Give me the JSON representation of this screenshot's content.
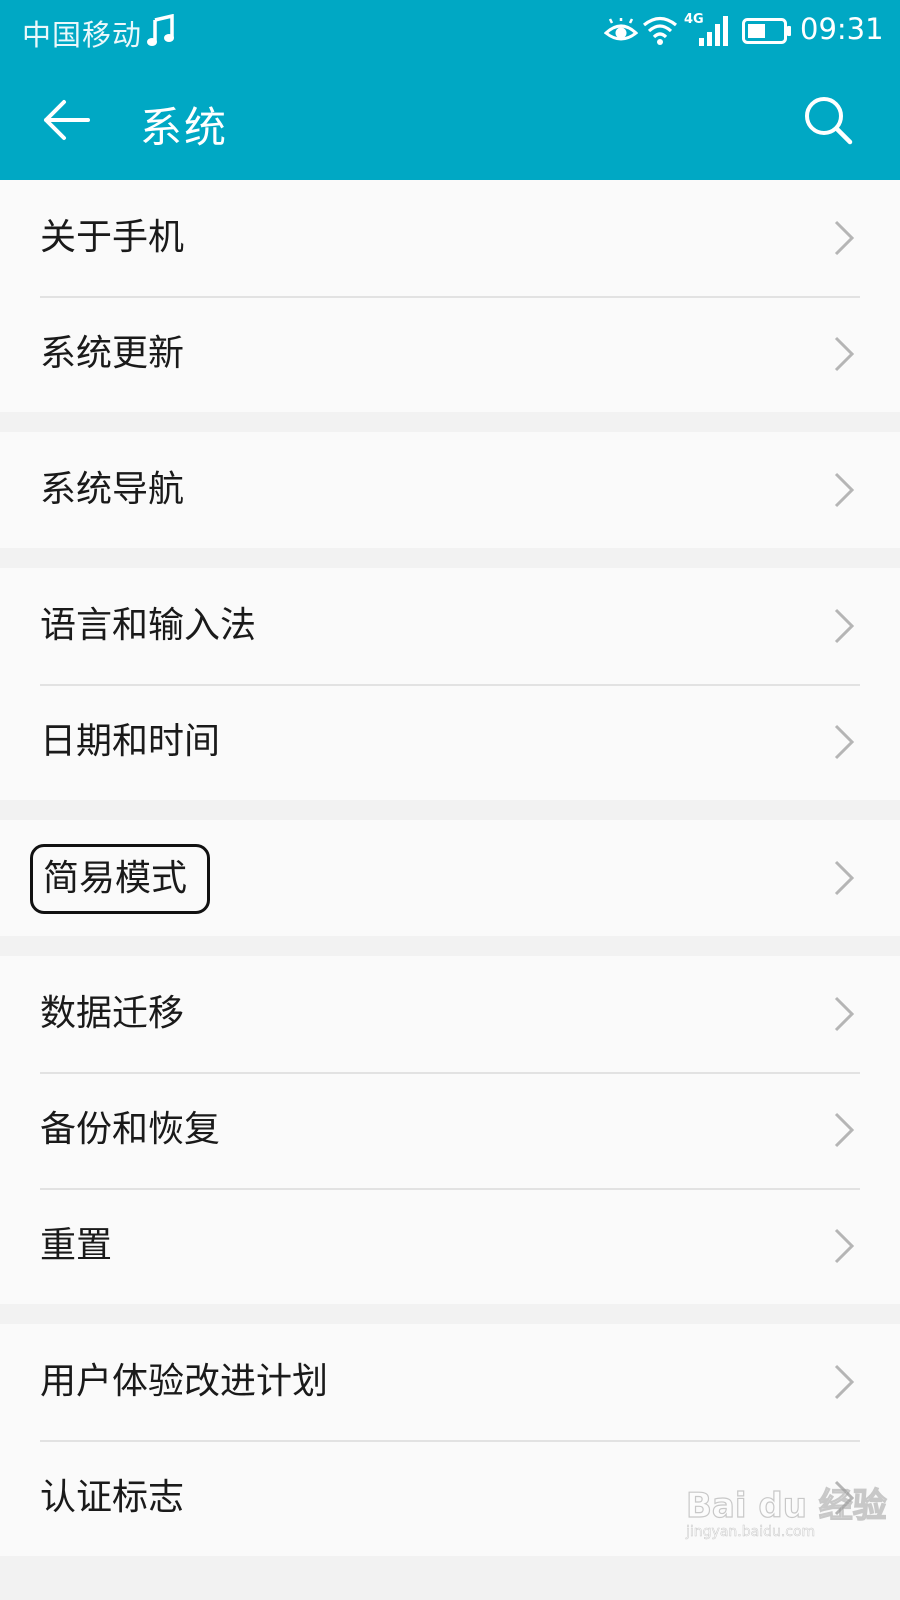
{
  "status_bar": {
    "carrier": "中国移动",
    "network": "4G",
    "time": "09:31",
    "icons": [
      "music-icon",
      "eye-icon",
      "wifi-icon",
      "signal-icon",
      "battery-icon"
    ]
  },
  "header": {
    "title": "系统",
    "back_icon": "back-arrow-icon",
    "search_icon": "search-icon",
    "color": "#00a8c4"
  },
  "groups": [
    {
      "items": [
        {
          "label": "关于手机"
        },
        {
          "label": "系统更新"
        }
      ]
    },
    {
      "items": [
        {
          "label": "系统导航"
        }
      ]
    },
    {
      "items": [
        {
          "label": "语言和输入法"
        },
        {
          "label": "日期和时间"
        }
      ]
    },
    {
      "items": [
        {
          "label": "简易模式",
          "highlighted": true
        }
      ]
    },
    {
      "items": [
        {
          "label": "数据迁移"
        },
        {
          "label": "备份和恢复"
        },
        {
          "label": "重置"
        }
      ]
    },
    {
      "items": [
        {
          "label": "用户体验改进计划"
        },
        {
          "label": "认证标志"
        }
      ]
    }
  ],
  "watermark": {
    "text": "Bai du 经验",
    "url": "jingyan.baidu.com"
  }
}
